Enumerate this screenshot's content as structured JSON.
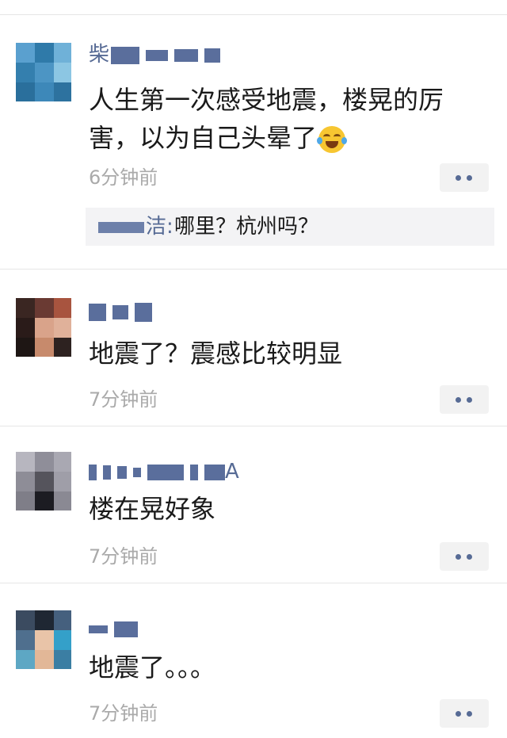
{
  "posts": [
    {
      "name_visible": "柴",
      "content": "人生第一次感受地震，楼晃的厉害，以为自己头晕了",
      "content_line1": "人生第一次感受地震，楼晃的厉",
      "content_line2": "害，以为自己头晕了",
      "emoji": "face-with-tears-of-joy-icon",
      "time": "6分钟前",
      "comment": {
        "author_visible": "洁",
        "separator": ":",
        "text": "哪里？杭州吗？"
      }
    },
    {
      "name_visible": "",
      "content": "地震了？震感比较明显",
      "time": "7分钟前"
    },
    {
      "name_visible": "A",
      "content": "楼在晃好象",
      "time": "7分钟前"
    },
    {
      "name_visible": "",
      "content": "地震了。。。",
      "time": "7分钟前"
    }
  ],
  "colors": {
    "name": "#576b95",
    "time": "#aaaaaa",
    "text": "#1a1a1a",
    "comment_bg": "#f3f3f5",
    "more_bg": "#f2f2f2"
  }
}
